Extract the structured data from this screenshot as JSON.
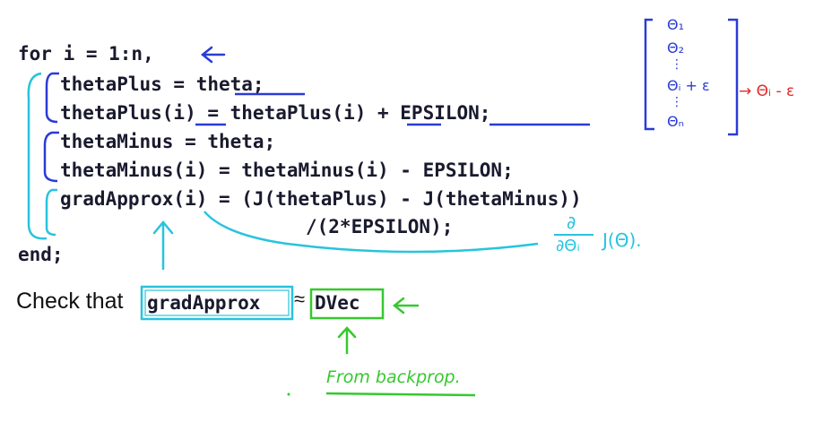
{
  "code": {
    "line1": "for i = 1:n,",
    "line2": "thetaPlus = theta;",
    "line3": "thetaPlus(i) = thetaPlus(i) + EPSILON;",
    "line4": "thetaMinus = theta;",
    "line5": "thetaMinus(i) = thetaMinus(i) - EPSILON;",
    "line6": "gradApprox(i) = (J(thetaPlus) - J(thetaMinus))",
    "line7": "/(2*EPSILON);",
    "line8": "end;"
  },
  "check": {
    "prefix": "Check that",
    "grad": "gradApprox",
    "approx": "≈",
    "dvec": "DVec"
  },
  "annotations": {
    "vector_entries": [
      "Θ₁",
      "Θ₂",
      "⋮",
      "Θᵢ + ε",
      "⋮",
      "Θₙ"
    ],
    "red_note": "→ Θᵢ - ε",
    "derivative_num": "∂",
    "derivative_den": "∂Θᵢ",
    "derivative_fn": "J(Θ).",
    "green_note": "From backprop."
  },
  "colors": {
    "blue_ink": "#2a3bd6",
    "cyan_ink": "#27c4dd",
    "green_ink": "#35c92e",
    "red_ink": "#e22a2a"
  }
}
